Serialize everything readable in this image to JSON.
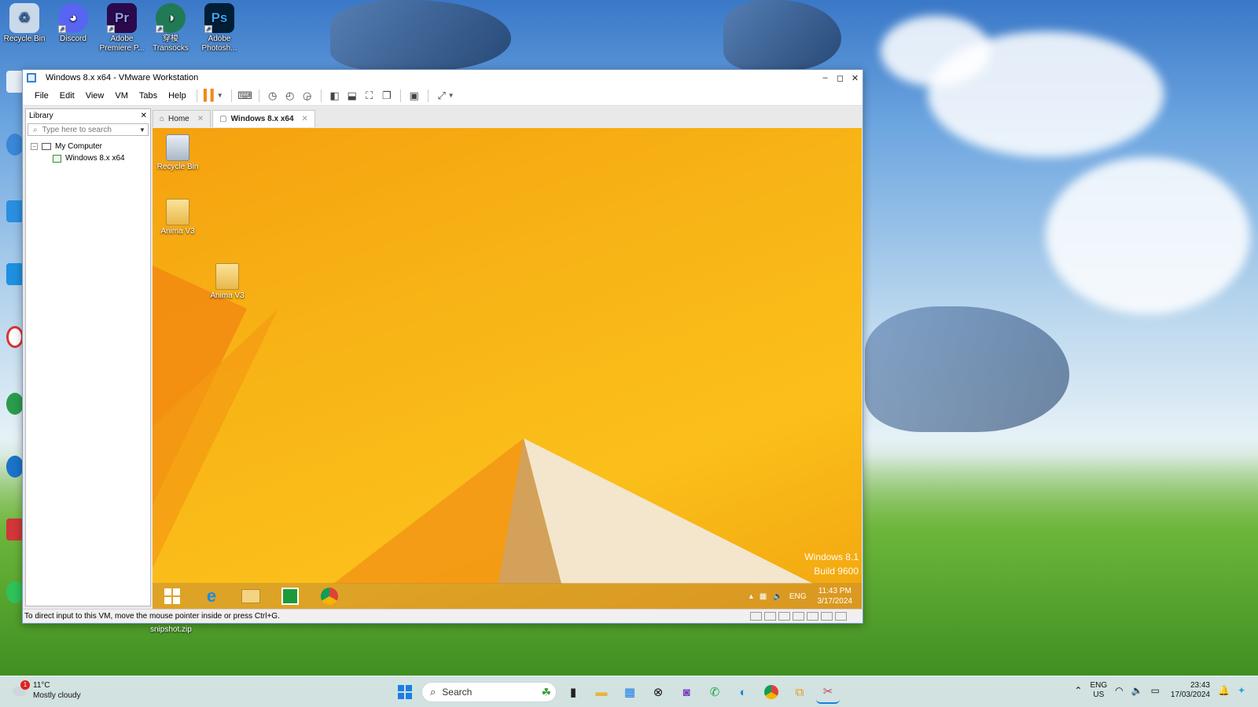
{
  "host_desktop": {
    "icons": [
      {
        "label": "Recycle Bin",
        "icon": "recycle-bin-icon",
        "color": "#c9d9ea"
      },
      {
        "label": "Discord",
        "icon": "discord-icon",
        "color": "#5865f2"
      },
      {
        "label": "Adobe Premiere P...",
        "icon": "premiere-pro-icon",
        "color": "#2a0a4d",
        "glyph": "Pr"
      },
      {
        "label": "Transocks",
        "icon": "transocks-icon",
        "color": "#1f7a55",
        "sublabel": "穿梭"
      },
      {
        "label": "Adobe Photosh...",
        "icon": "photoshop-icon",
        "color": "#001e36",
        "glyph": "Ps"
      }
    ],
    "snipshot_label": "snipshot.zip"
  },
  "vmware": {
    "title": "Windows 8.x x64 - VMware Workstation",
    "window_controls": {
      "minimize": "–",
      "maximize": "◻",
      "close": "✕"
    },
    "menu": [
      "File",
      "Edit",
      "View",
      "VM",
      "Tabs",
      "Help"
    ],
    "library": {
      "title": "Library",
      "close": "✕",
      "search_placeholder": "Type here to search",
      "tree_root": "My Computer",
      "tree_child": "Windows 8.x x64"
    },
    "tabs": [
      {
        "label": "Home",
        "active": false
      },
      {
        "label": "Windows 8.x x64",
        "active": true
      }
    ],
    "status_text": "To direct input to this VM, move the mouse pointer inside or press Ctrl+G."
  },
  "guest": {
    "icons": [
      {
        "label": "Recycle Bin",
        "icon": "recycle-bin-icon"
      },
      {
        "label": "Anima V3",
        "icon": "folder-icon"
      },
      {
        "label": "Anima V3",
        "icon": "zip-folder-icon"
      }
    ],
    "watermark": {
      "line1": "Windows 8.1",
      "line2": "Build 9600"
    },
    "taskbar_tray": {
      "lang": "ENG",
      "time": "11:43 PM",
      "date": "3/17/2024"
    }
  },
  "host_taskbar": {
    "weather": {
      "temp": "11°C",
      "desc": "Mostly cloudy",
      "badge": "1"
    },
    "search_label": "Search",
    "tray": {
      "lang1": "ENG",
      "lang2": "US",
      "time": "23:43",
      "date": "17/03/2024"
    }
  }
}
